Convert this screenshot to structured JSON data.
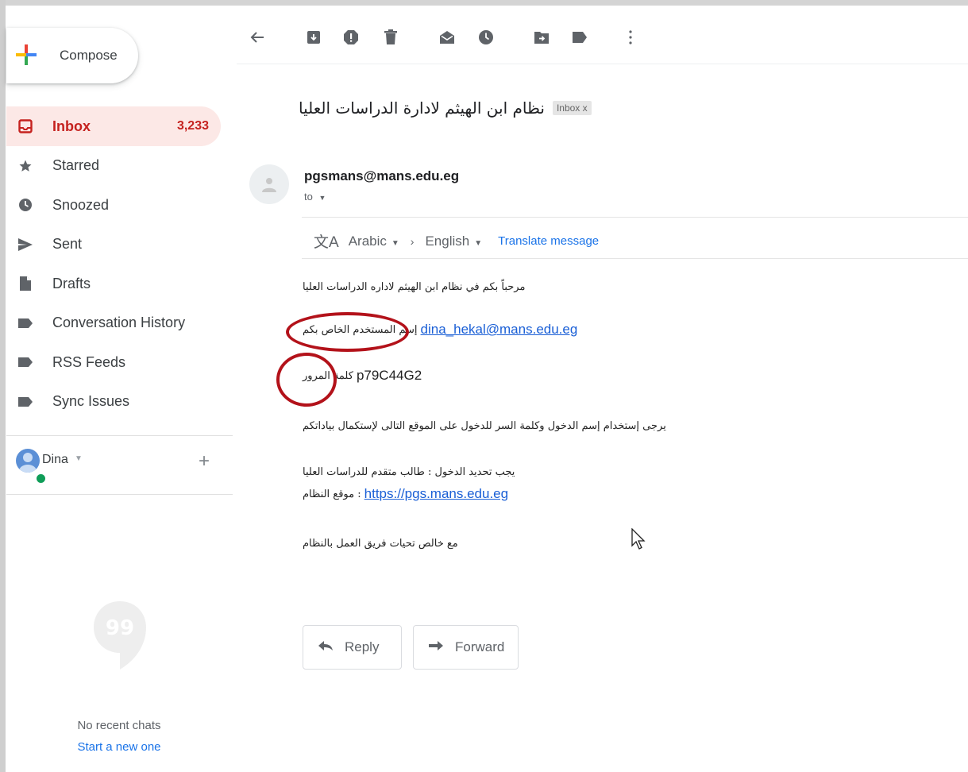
{
  "sidebar": {
    "compose_label": "Compose",
    "items": [
      {
        "label": "Inbox",
        "count": "3,233",
        "icon": "inbox-icon"
      },
      {
        "label": "Starred",
        "count": "",
        "icon": "star-icon"
      },
      {
        "label": "Snoozed",
        "count": "",
        "icon": "clock-icon"
      },
      {
        "label": "Sent",
        "count": "",
        "icon": "send-icon"
      },
      {
        "label": "Drafts",
        "count": "",
        "icon": "draft-icon"
      },
      {
        "label": "Conversation History",
        "count": "",
        "icon": "label-icon"
      },
      {
        "label": "RSS Feeds",
        "count": "",
        "icon": "label-icon"
      },
      {
        "label": "Sync Issues",
        "count": "",
        "icon": "label-icon"
      }
    ],
    "user_name": "Dina",
    "no_chats": "No recent chats",
    "new_chat": "Start a new one"
  },
  "toolbar": {
    "icons": [
      "back-arrow-icon",
      "archive-icon",
      "report-spam-icon",
      "delete-icon",
      "mark-unread-icon",
      "snooze-icon",
      "move-to-icon",
      "labels-icon",
      "more-vert-icon"
    ]
  },
  "message": {
    "subject": "نظام ابن الهيثم لادارة الدراسات العليا",
    "badge": "Inbox x",
    "sender": "pgsmans@mans.edu.eg",
    "to_label": "to",
    "translate": {
      "from_lang": "Arabic",
      "to_lang": "English",
      "action": "Translate message"
    },
    "body": {
      "greeting": "مرحباً بكم في نظام ابن الهيثم لاداره الدراسات العليا",
      "username_label": "إسم المستخدم الخاص بكم",
      "username_value": "dina_hekal@mans.edu.eg",
      "password_label": "كلمة المرور",
      "password_value": "p79C44G2",
      "instruction": "يرجى إستخدام إسم الدخول وكلمة السر للدخول على الموقع التالى لإستكمال بياداتكم",
      "role_line": "يجب تحديد الدخول : طالب متقدم للدراسات العليا",
      "site_label": ": موقع النظام",
      "site_url": "https://pgs.mans.edu.eg",
      "closing": "مع خالص تحيات فريق العمل بالنظام"
    },
    "reply_label": "Reply",
    "forward_label": "Forward"
  },
  "colors": {
    "accent_red": "#c5221f",
    "active_bg": "#fce8e6",
    "link_blue": "#1a73e8",
    "annotation_circle": "#b3121a"
  }
}
